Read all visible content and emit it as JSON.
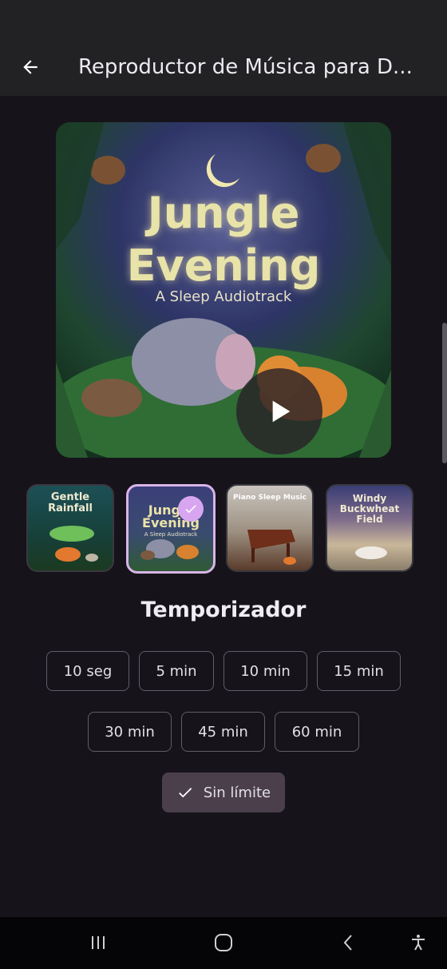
{
  "header": {
    "title": "Reproductor de Música para D..."
  },
  "player": {
    "cover": {
      "title_line1": "Jungle",
      "title_line2": "Evening",
      "subtitle": "A Sleep Audiotrack"
    }
  },
  "tracks": [
    {
      "title_line1": "Gentle",
      "title_line2": "Rainfall",
      "selected": false
    },
    {
      "title_line1": "Jungle",
      "title_line2": "Evening",
      "subtitle": "A Sleep Audiotrack",
      "selected": true
    },
    {
      "title_line1": "Piano Sleep Music",
      "title_line2": "",
      "selected": false
    },
    {
      "title_line1": "Windy",
      "title_line2": "Buckwheat",
      "title_line3": "Field",
      "selected": false
    }
  ],
  "timer": {
    "title": "Temporizador",
    "options": [
      "10 seg",
      "5 min",
      "10 min",
      "15 min",
      "30 min",
      "45 min",
      "60 min"
    ],
    "unlimited": "Sin límite",
    "selected": "Sin límite"
  },
  "colors": {
    "accent": "#d8a6f0",
    "background": "#16141a",
    "chip_selected": "#4b3f4b"
  }
}
